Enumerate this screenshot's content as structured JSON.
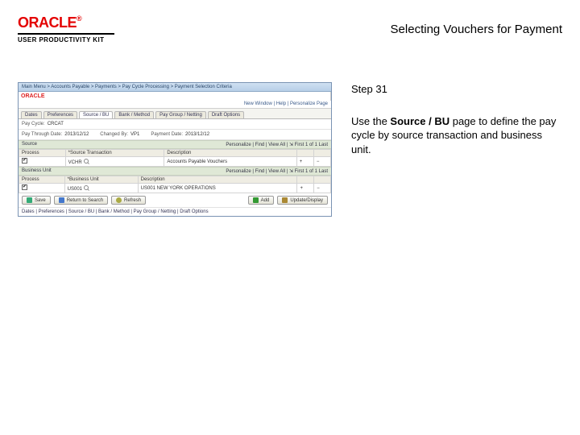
{
  "header": {
    "brand": "ORACLE",
    "reg": "®",
    "productLine": "USER PRODUCTIVITY KIT",
    "docTitle": "Selecting Vouchers for Payment"
  },
  "instruction": {
    "stepLabel": "Step 31",
    "line1": "Use the ",
    "bold": "Source / BU",
    "line2": " page to define the pay cycle by source transaction and business unit."
  },
  "app": {
    "breadcrumb": "Main Menu  >  Accounts Payable  >  Payments  >  Pay Cycle Processing  >  Payment Selection Criteria",
    "brand": "ORACLE",
    "windowLinks": "New Window | Help | Personalize Page",
    "tabs": [
      "Dates",
      "Preferences",
      "Source / BU",
      "Bank / Method",
      "Pay Group / Netting",
      "Draft Options"
    ],
    "activeTabIndex": 2,
    "payCycleLabel": "Pay Cycle:",
    "payCycleValue": "CRCAT",
    "payThroughLabel": "Pay Through Date:",
    "payThroughValue": "2013/12/12",
    "changedByLabel": "Changed By:",
    "changedByValue": "VP1",
    "paymentDateLabel": "Payment Date:",
    "paymentDateValue": "2013/12/12",
    "sourceSection": "Source",
    "sourceNav": "Personalize | Find | View All | ⇲   First 1 of 1 Last",
    "sourceCols": [
      "Process",
      "*Source Transaction",
      "Description",
      "",
      ""
    ],
    "sourceRow": {
      "process": true,
      "txn": "VCHR",
      "desc": "Accounts Payable Vouchers",
      "plus": "+",
      "minus": "−"
    },
    "buSection": "Business Unit",
    "buNav": "Personalize | Find | View All | ⇲   First 1 of 1 Last",
    "buCols": [
      "Process",
      "*Business Unit",
      "Description",
      "",
      ""
    ],
    "buRow": {
      "process": true,
      "bu": "US001",
      "desc": "US001 NEW YORK OPERATIONS",
      "plus": "+",
      "minus": "−"
    },
    "btnSave": "Save",
    "btnReturn": "Return to Search",
    "btnRefresh": "Refresh",
    "btnAdd": "Add",
    "btnUpdate": "Update/Display",
    "statusLine": "Dates | Preferences | Source / BU | Bank / Method | Pay Group / Netting | Draft Options"
  }
}
